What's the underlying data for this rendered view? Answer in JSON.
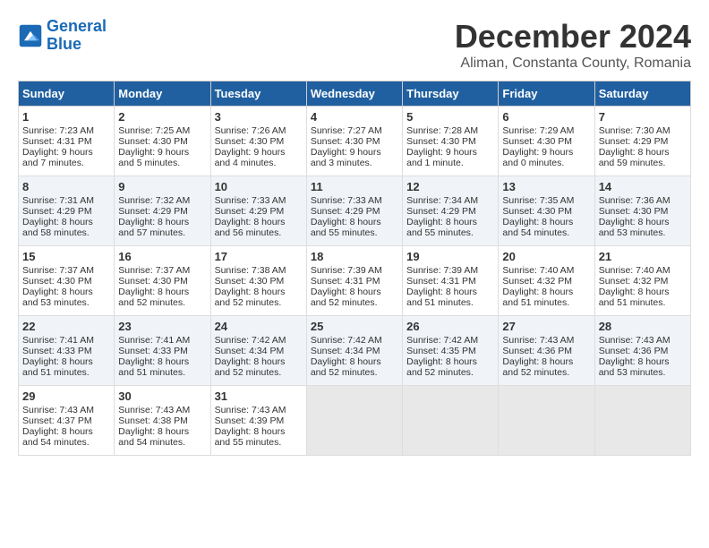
{
  "header": {
    "logo_line1": "General",
    "logo_line2": "Blue",
    "month_year": "December 2024",
    "location": "Aliman, Constanta County, Romania"
  },
  "days_of_week": [
    "Sunday",
    "Monday",
    "Tuesday",
    "Wednesday",
    "Thursday",
    "Friday",
    "Saturday"
  ],
  "weeks": [
    [
      {
        "day": "1",
        "lines": [
          "Sunrise: 7:23 AM",
          "Sunset: 4:31 PM",
          "Daylight: 9 hours",
          "and 7 minutes."
        ]
      },
      {
        "day": "2",
        "lines": [
          "Sunrise: 7:25 AM",
          "Sunset: 4:30 PM",
          "Daylight: 9 hours",
          "and 5 minutes."
        ]
      },
      {
        "day": "3",
        "lines": [
          "Sunrise: 7:26 AM",
          "Sunset: 4:30 PM",
          "Daylight: 9 hours",
          "and 4 minutes."
        ]
      },
      {
        "day": "4",
        "lines": [
          "Sunrise: 7:27 AM",
          "Sunset: 4:30 PM",
          "Daylight: 9 hours",
          "and 3 minutes."
        ]
      },
      {
        "day": "5",
        "lines": [
          "Sunrise: 7:28 AM",
          "Sunset: 4:30 PM",
          "Daylight: 9 hours",
          "and 1 minute."
        ]
      },
      {
        "day": "6",
        "lines": [
          "Sunrise: 7:29 AM",
          "Sunset: 4:30 PM",
          "Daylight: 9 hours",
          "and 0 minutes."
        ]
      },
      {
        "day": "7",
        "lines": [
          "Sunrise: 7:30 AM",
          "Sunset: 4:29 PM",
          "Daylight: 8 hours",
          "and 59 minutes."
        ]
      }
    ],
    [
      {
        "day": "8",
        "lines": [
          "Sunrise: 7:31 AM",
          "Sunset: 4:29 PM",
          "Daylight: 8 hours",
          "and 58 minutes."
        ]
      },
      {
        "day": "9",
        "lines": [
          "Sunrise: 7:32 AM",
          "Sunset: 4:29 PM",
          "Daylight: 8 hours",
          "and 57 minutes."
        ]
      },
      {
        "day": "10",
        "lines": [
          "Sunrise: 7:33 AM",
          "Sunset: 4:29 PM",
          "Daylight: 8 hours",
          "and 56 minutes."
        ]
      },
      {
        "day": "11",
        "lines": [
          "Sunrise: 7:33 AM",
          "Sunset: 4:29 PM",
          "Daylight: 8 hours",
          "and 55 minutes."
        ]
      },
      {
        "day": "12",
        "lines": [
          "Sunrise: 7:34 AM",
          "Sunset: 4:29 PM",
          "Daylight: 8 hours",
          "and 55 minutes."
        ]
      },
      {
        "day": "13",
        "lines": [
          "Sunrise: 7:35 AM",
          "Sunset: 4:30 PM",
          "Daylight: 8 hours",
          "and 54 minutes."
        ]
      },
      {
        "day": "14",
        "lines": [
          "Sunrise: 7:36 AM",
          "Sunset: 4:30 PM",
          "Daylight: 8 hours",
          "and 53 minutes."
        ]
      }
    ],
    [
      {
        "day": "15",
        "lines": [
          "Sunrise: 7:37 AM",
          "Sunset: 4:30 PM",
          "Daylight: 8 hours",
          "and 53 minutes."
        ]
      },
      {
        "day": "16",
        "lines": [
          "Sunrise: 7:37 AM",
          "Sunset: 4:30 PM",
          "Daylight: 8 hours",
          "and 52 minutes."
        ]
      },
      {
        "day": "17",
        "lines": [
          "Sunrise: 7:38 AM",
          "Sunset: 4:30 PM",
          "Daylight: 8 hours",
          "and 52 minutes."
        ]
      },
      {
        "day": "18",
        "lines": [
          "Sunrise: 7:39 AM",
          "Sunset: 4:31 PM",
          "Daylight: 8 hours",
          "and 52 minutes."
        ]
      },
      {
        "day": "19",
        "lines": [
          "Sunrise: 7:39 AM",
          "Sunset: 4:31 PM",
          "Daylight: 8 hours",
          "and 51 minutes."
        ]
      },
      {
        "day": "20",
        "lines": [
          "Sunrise: 7:40 AM",
          "Sunset: 4:32 PM",
          "Daylight: 8 hours",
          "and 51 minutes."
        ]
      },
      {
        "day": "21",
        "lines": [
          "Sunrise: 7:40 AM",
          "Sunset: 4:32 PM",
          "Daylight: 8 hours",
          "and 51 minutes."
        ]
      }
    ],
    [
      {
        "day": "22",
        "lines": [
          "Sunrise: 7:41 AM",
          "Sunset: 4:33 PM",
          "Daylight: 8 hours",
          "and 51 minutes."
        ]
      },
      {
        "day": "23",
        "lines": [
          "Sunrise: 7:41 AM",
          "Sunset: 4:33 PM",
          "Daylight: 8 hours",
          "and 51 minutes."
        ]
      },
      {
        "day": "24",
        "lines": [
          "Sunrise: 7:42 AM",
          "Sunset: 4:34 PM",
          "Daylight: 8 hours",
          "and 52 minutes."
        ]
      },
      {
        "day": "25",
        "lines": [
          "Sunrise: 7:42 AM",
          "Sunset: 4:34 PM",
          "Daylight: 8 hours",
          "and 52 minutes."
        ]
      },
      {
        "day": "26",
        "lines": [
          "Sunrise: 7:42 AM",
          "Sunset: 4:35 PM",
          "Daylight: 8 hours",
          "and 52 minutes."
        ]
      },
      {
        "day": "27",
        "lines": [
          "Sunrise: 7:43 AM",
          "Sunset: 4:36 PM",
          "Daylight: 8 hours",
          "and 52 minutes."
        ]
      },
      {
        "day": "28",
        "lines": [
          "Sunrise: 7:43 AM",
          "Sunset: 4:36 PM",
          "Daylight: 8 hours",
          "and 53 minutes."
        ]
      }
    ],
    [
      {
        "day": "29",
        "lines": [
          "Sunrise: 7:43 AM",
          "Sunset: 4:37 PM",
          "Daylight: 8 hours",
          "and 54 minutes."
        ]
      },
      {
        "day": "30",
        "lines": [
          "Sunrise: 7:43 AM",
          "Sunset: 4:38 PM",
          "Daylight: 8 hours",
          "and 54 minutes."
        ]
      },
      {
        "day": "31",
        "lines": [
          "Sunrise: 7:43 AM",
          "Sunset: 4:39 PM",
          "Daylight: 8 hours",
          "and 55 minutes."
        ]
      },
      null,
      null,
      null,
      null
    ]
  ]
}
